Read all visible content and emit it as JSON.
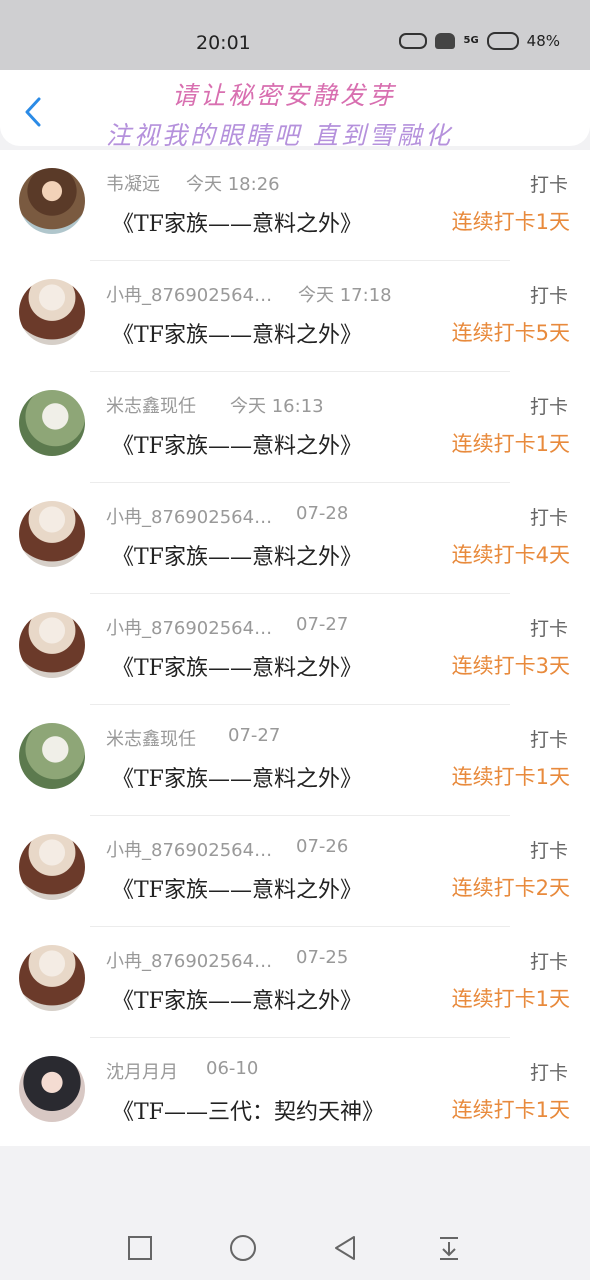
{
  "status": {
    "time": "20:01",
    "network": "5G",
    "battery": "48%"
  },
  "header": {
    "banner_line1": "请让秘密安静发芽",
    "banner_line2": "注视我的眼睛吧 直到雪融化"
  },
  "rows": [
    {
      "avatar": "girl-avatar",
      "name": "韦凝远",
      "time": "今天 18:26",
      "type": "打卡",
      "title": "《TF家族——意料之外》",
      "streak": "连续打卡1天"
    },
    {
      "avatar": "anime-boy-avatar",
      "name": "小冉_876902564…",
      "time": "今天 17:18",
      "type": "打卡",
      "title": "《TF家族——意料之外》",
      "streak": "连续打卡5天"
    },
    {
      "avatar": "green-boy-avatar",
      "name": "米志鑫现任",
      "time": "今天 16:13",
      "type": "打卡",
      "title": "《TF家族——意料之外》",
      "streak": "连续打卡1天"
    },
    {
      "avatar": "anime-boy-avatar",
      "name": "小冉_876902564…",
      "time": "07-28",
      "type": "打卡",
      "title": "《TF家族——意料之外》",
      "streak": "连续打卡4天"
    },
    {
      "avatar": "anime-boy-avatar",
      "name": "小冉_876902564…",
      "time": "07-27",
      "type": "打卡",
      "title": "《TF家族——意料之外》",
      "streak": "连续打卡3天"
    },
    {
      "avatar": "green-boy-avatar",
      "name": "米志鑫现任",
      "time": "07-27",
      "type": "打卡",
      "title": "《TF家族——意料之外》",
      "streak": "连续打卡1天"
    },
    {
      "avatar": "anime-boy-avatar",
      "name": "小冉_876902564…",
      "time": "07-26",
      "type": "打卡",
      "title": "《TF家族——意料之外》",
      "streak": "连续打卡2天"
    },
    {
      "avatar": "anime-boy-avatar",
      "name": "小冉_876902564…",
      "time": "07-25",
      "type": "打卡",
      "title": "《TF家族——意料之外》",
      "streak": "连续打卡1天"
    },
    {
      "avatar": "ancient-girl-avatar",
      "name": "沈月月月",
      "time": "06-10",
      "type": "打卡",
      "title": "《TF——三代：契约天神》",
      "streak": "连续打卡1天"
    }
  ],
  "nav": {
    "icons": [
      "recent-apps-icon",
      "home-icon",
      "back-icon",
      "notification-pull-icon"
    ]
  },
  "colors": {
    "accent": "#e88a3c",
    "back": "#2b8be6"
  }
}
